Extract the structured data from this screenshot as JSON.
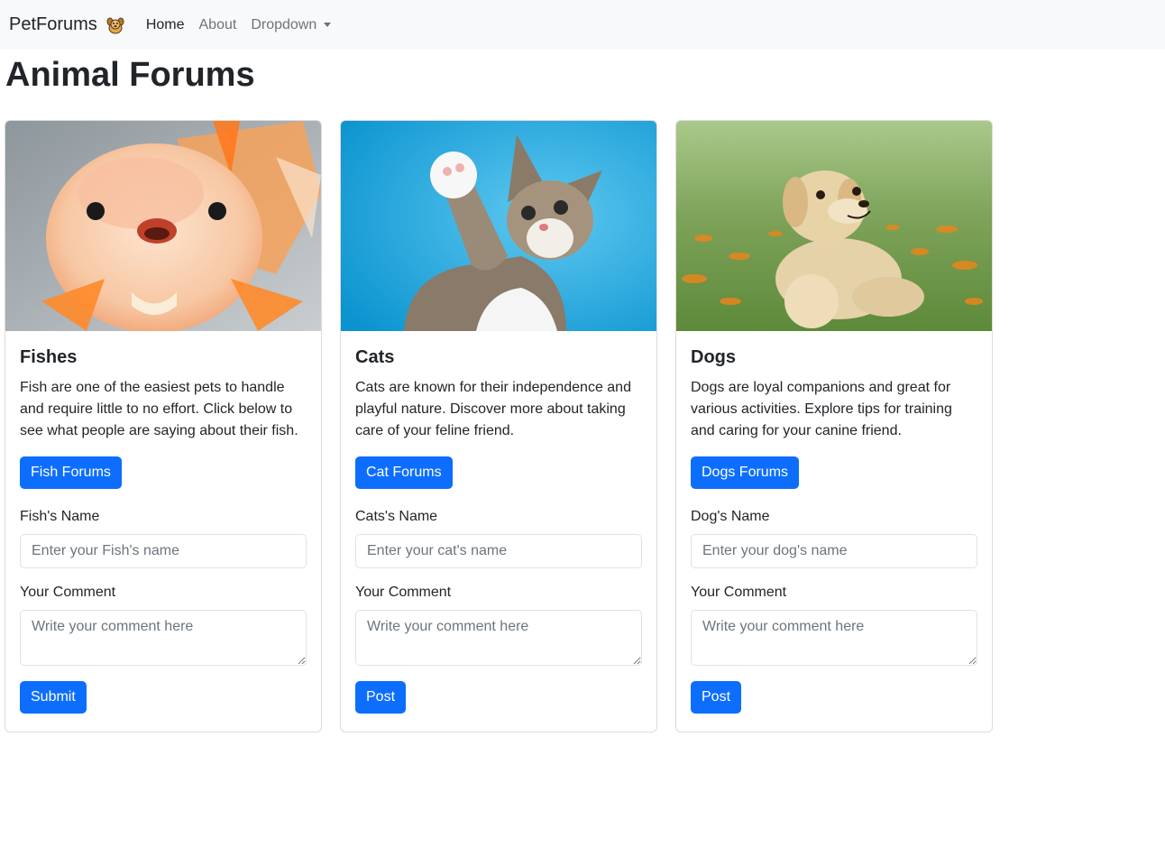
{
  "navbar": {
    "brand": "PetForums",
    "brand_icon": "dog-emoji-icon",
    "links": [
      {
        "label": "Home"
      },
      {
        "label": "About"
      },
      {
        "label": "Dropdown"
      }
    ]
  },
  "page": {
    "title": "Animal Forums"
  },
  "cards": [
    {
      "image": "goldfish-photo",
      "title": "Fishes",
      "text": "Fish are one of the easiest pets to handle and require little to no effort. Click below to see what people are saying about their fish.",
      "button": "Fish Forums",
      "name_label": "Fish's Name",
      "name_placeholder": "Enter your Fish's name",
      "comment_label": "Your Comment",
      "comment_placeholder": "Write your comment here",
      "submit": "Submit"
    },
    {
      "image": "cat-photo",
      "title": "Cats",
      "text": "Cats are known for their independence and playful nature. Discover more about taking care of your feline friend.",
      "button": "Cat Forums",
      "name_label": "Cats's Name",
      "name_placeholder": "Enter your cat's name",
      "comment_label": "Your Comment",
      "comment_placeholder": "Write your comment here",
      "submit": "Post"
    },
    {
      "image": "dog-photo",
      "title": "Dogs",
      "text": "Dogs are loyal companions and great for various activities. Explore tips for training and caring for your canine friend.",
      "button": "Dogs Forums",
      "name_label": "Dog's Name",
      "name_placeholder": "Enter your dog's name",
      "comment_label": "Your Comment",
      "comment_placeholder": "Write your comment here",
      "submit": "Post"
    }
  ],
  "colors": {
    "primary": "#0d6efd",
    "navbar_bg": "#f8f9fa",
    "text": "#212529"
  }
}
